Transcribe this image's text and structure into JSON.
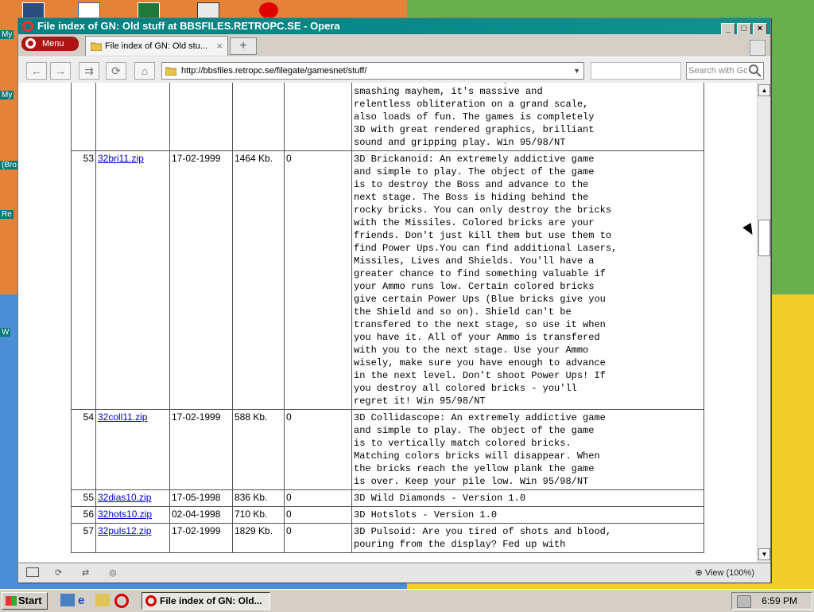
{
  "window": {
    "title": "File index of GN: Old stuff at BBSFILES.RETROPC.SE - Opera",
    "controls": {
      "minimize": "_",
      "maximize": "□",
      "close": "×"
    }
  },
  "browser": {
    "menu_label": "Menu",
    "tab_title": "File index of GN: Old stu...",
    "tab_close": "×",
    "new_tab": "+",
    "address": "http://bbsfiles.retropc.se/filegate/gamesnet/stuff/",
    "search_placeholder": "Search with Google",
    "nav": {
      "back": "←",
      "forward": "→",
      "fast_forward": "⇉",
      "reload": "⟳",
      "home": "⌂"
    }
  },
  "desktop": {
    "labels": [
      "My",
      "My",
      "(Bro",
      "Re",
      "W"
    ]
  },
  "files": [
    {
      "num": "",
      "name": "",
      "date": "",
      "size": "",
      "dl": "",
      "desc": "levels of asteroid blasting, rock\nsmashing mayhem, it's massive and\nrelentless obliteration on a grand scale,\nalso loads of fun. The games is completely\n3D with great rendered graphics, brilliant\nsound and gripping play. Win 95/98/NT"
    },
    {
      "num": "53",
      "name": "32bri11.zip",
      "date": "17-02-1999",
      "size": "1464 Kb.",
      "dl": "0",
      "desc": "3D Brickanoid: An extremely addictive game\nand simple to play. The object of the game\nis to destroy the Boss and advance to the\nnext stage. The Boss is hiding behind the\nrocky bricks. You can only destroy the bricks\nwith the Missiles. Colored bricks are your\nfriends. Don't just kill them but use them to\nfind Power Ups.You can find additional Lasers,\nMissiles, Lives and Shields. You'll have a\ngreater chance to find something valuable if\nyour Ammo runs low. Certain colored bricks\ngive certain Power Ups (Blue bricks give you\nthe Shield and so on). Shield can't be\ntransfered to the next stage, so use it when\nyou have it. All of your Ammo is transfered\nwith you to the next stage. Use your Ammo\nwisely, make sure you have enough to advance\nin the next level. Don't shoot Power Ups! If\nyou destroy all colored bricks - you'll\nregret it! Win 95/98/NT"
    },
    {
      "num": "54",
      "name": "32coll11.zip",
      "date": "17-02-1999",
      "size": "588 Kb.",
      "dl": "0",
      "desc": "3D Collidascope: An extremely addictive game\nand simple to play. The object of the game\nis to vertically match colored bricks.\nMatching colors bricks will disappear. When\nthe bricks reach the yellow plank the game\nis over. Keep your pile low. Win 95/98/NT"
    },
    {
      "num": "55",
      "name": "32dias10.zip",
      "date": "17-05-1998",
      "size": "836 Kb.",
      "dl": "0",
      "desc": "3D Wild Diamonds - Version 1.0"
    },
    {
      "num": "56",
      "name": "32hots10.zip",
      "date": "02-04-1998",
      "size": "710 Kb.",
      "dl": "0",
      "desc": "3D Hotslots - Version 1.0"
    },
    {
      "num": "57",
      "name": "32puls12.zip",
      "date": "17-02-1999",
      "size": "1829 Kb.",
      "dl": "0",
      "desc": "3D Pulsoid: Are you tired of shots and blood,\npouring from the display? Fed up with"
    }
  ],
  "statusbar": {
    "zoom": "View (100%)"
  },
  "taskbar": {
    "start_label": "Start",
    "task_label": "File index of GN: Old...",
    "clock": "6:59 PM"
  },
  "colors": {
    "titlebar": "#008080",
    "link": "#0000cc",
    "opera_red": "#d40000"
  }
}
